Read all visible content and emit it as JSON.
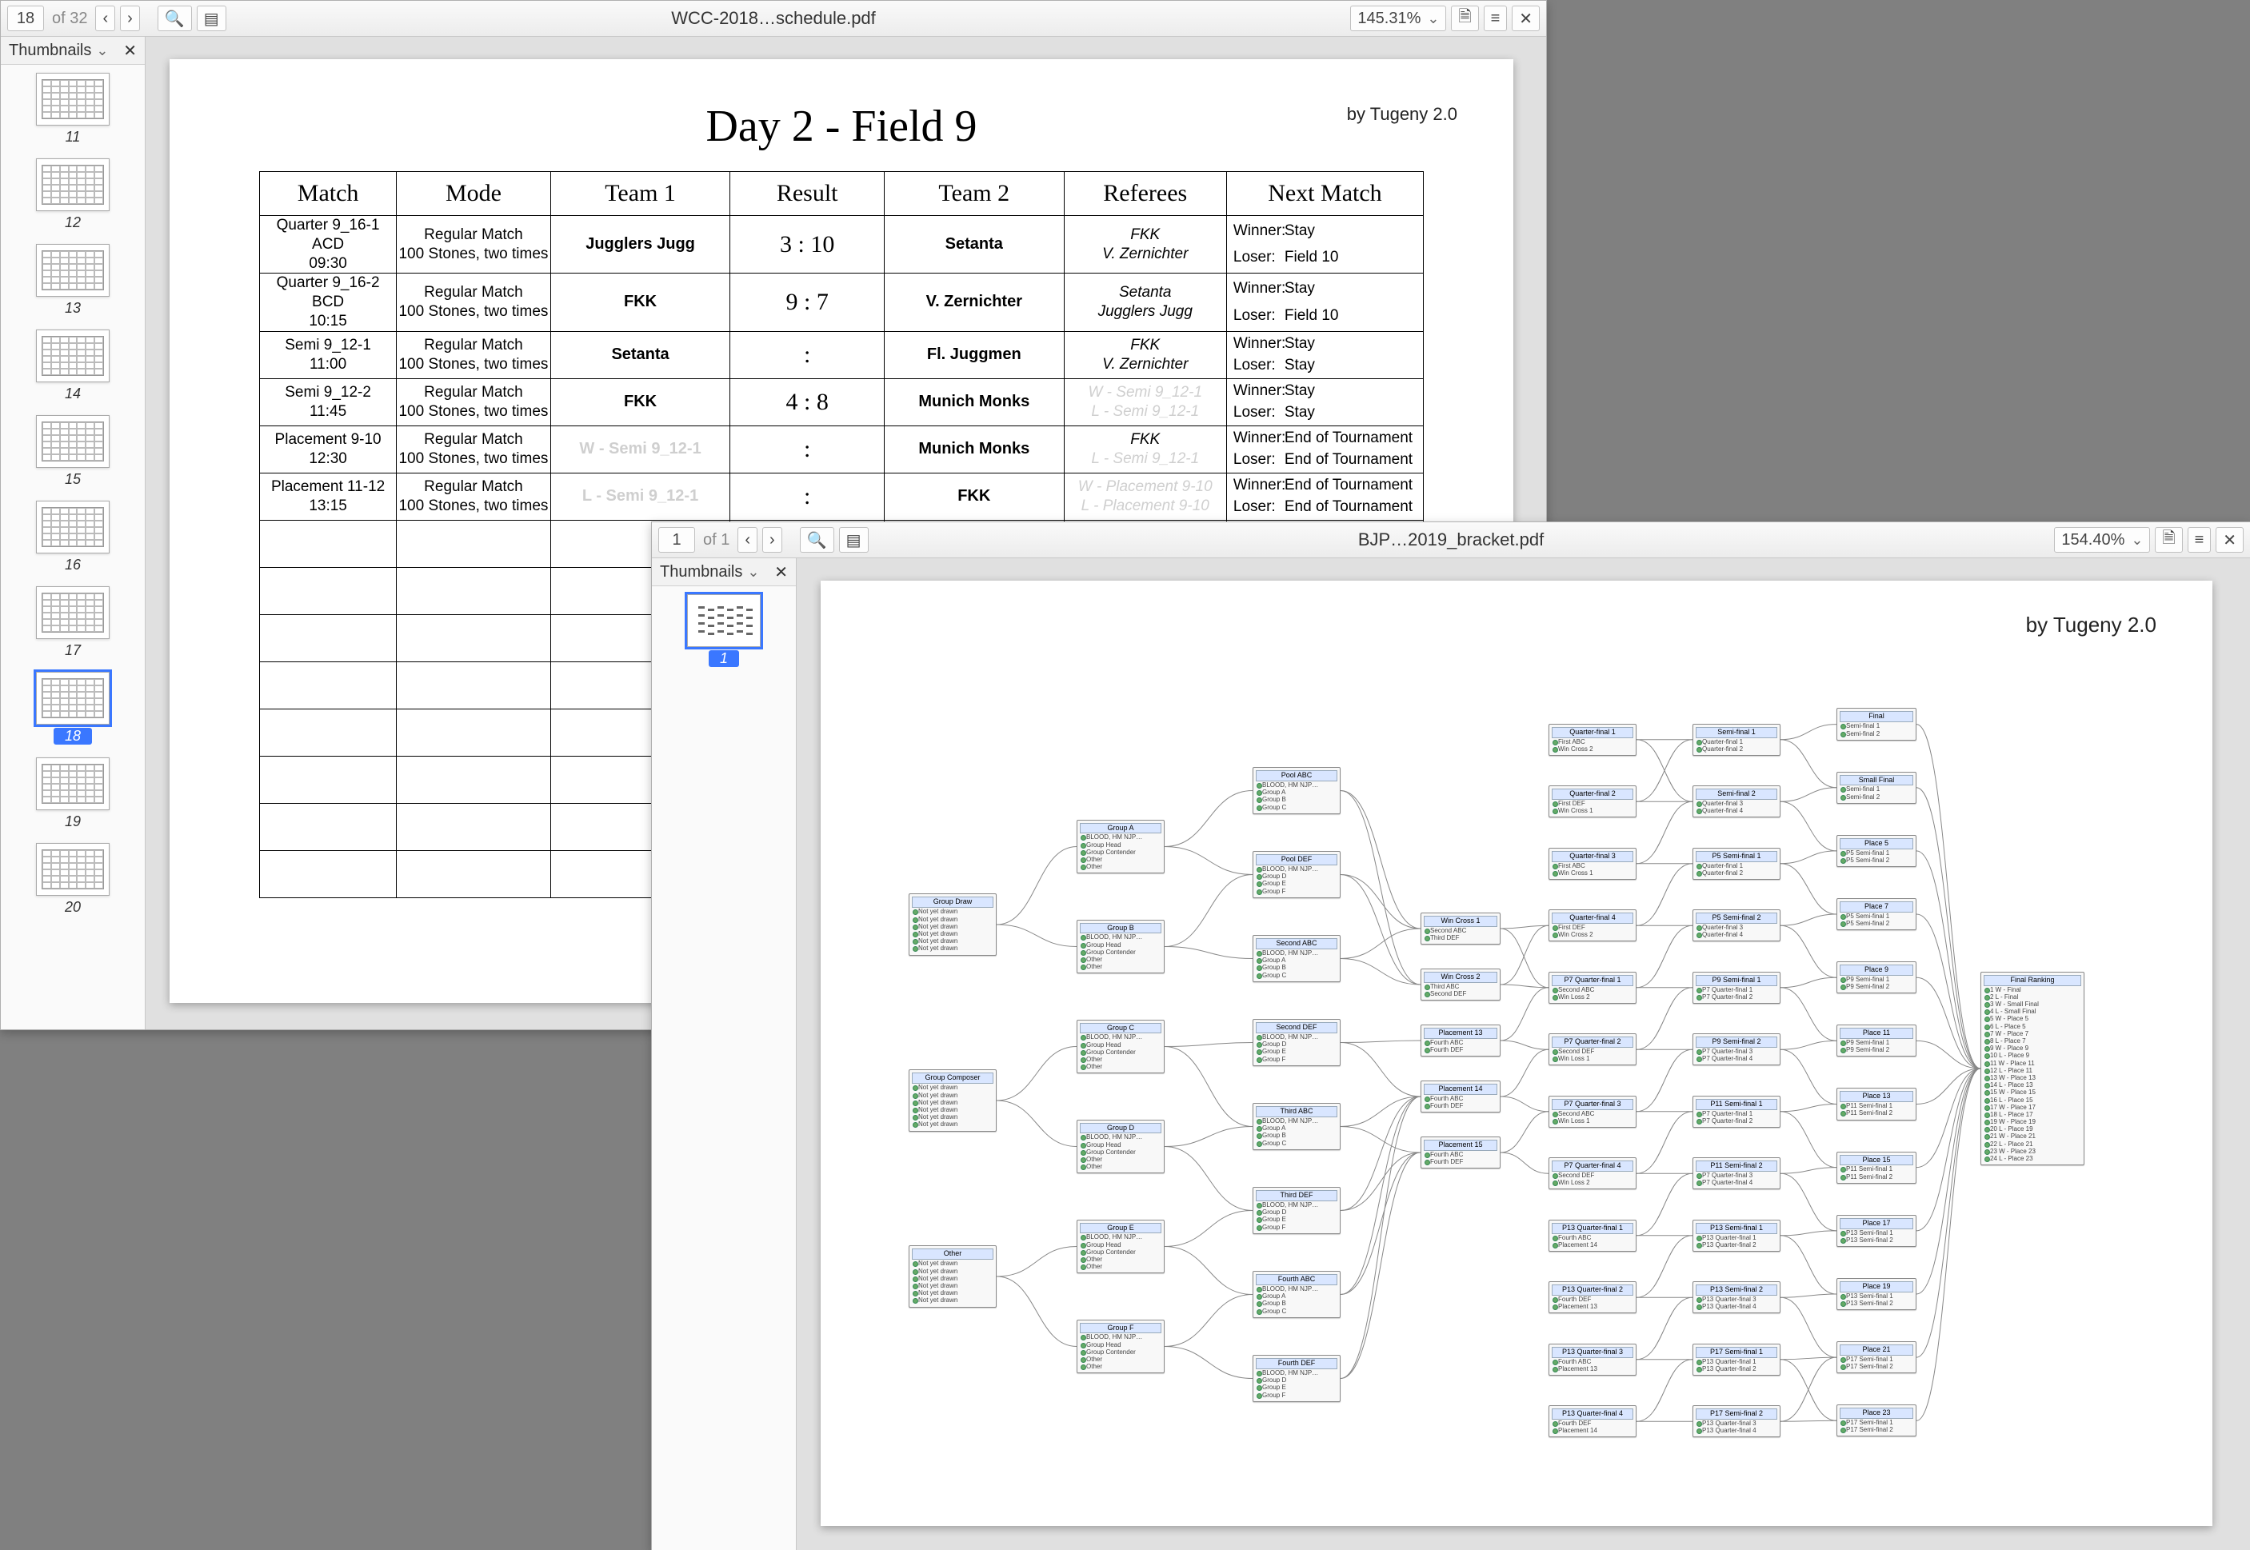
{
  "win1": {
    "page_input": "18",
    "page_total": "of 32",
    "title": "WCC-2018…schedule.pdf",
    "zoom": "145.31%",
    "thumbs_label": "Thumbnails",
    "thumbs": [
      {
        "n": "11"
      },
      {
        "n": "12"
      },
      {
        "n": "13"
      },
      {
        "n": "14"
      },
      {
        "n": "15"
      },
      {
        "n": "16"
      },
      {
        "n": "17"
      },
      {
        "n": "18",
        "selected": true
      },
      {
        "n": "19"
      },
      {
        "n": "20"
      }
    ],
    "byline": "by Tugeny 2.0",
    "page_heading": "Day 2 - Field 9",
    "headers": [
      "Match",
      "Mode",
      "Team 1",
      "Result",
      "Team 2",
      "Referees",
      "Next Match"
    ],
    "next_labels": {
      "winner": "Winner:",
      "loser": "Loser:"
    },
    "rows": [
      {
        "match_l1": "Quarter 9_16-1 ACD",
        "match_l2": "09:30",
        "mode_l1": "Regular Match",
        "mode_l2": "100 Stones, two times",
        "team1": "Jugglers Jugg",
        "team1_ghost": false,
        "result": "3 : 10",
        "team2": "Setanta",
        "team2_ghost": false,
        "ref_l1": "FKK",
        "ref_l2": "V. Zernichter",
        "ref_ghost": false,
        "next_w": "Stay",
        "next_l": "Field 10"
      },
      {
        "match_l1": "Quarter 9_16-2 BCD",
        "match_l2": "10:15",
        "mode_l1": "Regular Match",
        "mode_l2": "100 Stones, two times",
        "team1": "FKK",
        "team1_ghost": false,
        "result": "9 : 7",
        "team2": "V. Zernichter",
        "team2_ghost": false,
        "ref_l1": "Setanta",
        "ref_l2": "Jugglers Jugg",
        "ref_ghost": false,
        "next_w": "Stay",
        "next_l": "Field 10"
      },
      {
        "match_l1": "Semi 9_12-1",
        "match_l2": "11:00",
        "mode_l1": "Regular Match",
        "mode_l2": "100 Stones, two times",
        "team1": "Setanta",
        "team1_ghost": false,
        "result": ":",
        "team2": "Fl. Juggmen",
        "team2_ghost": false,
        "ref_l1": "FKK",
        "ref_l2": "V. Zernichter",
        "ref_ghost": false,
        "next_w": "Stay",
        "next_l": "Stay"
      },
      {
        "match_l1": "Semi 9_12-2",
        "match_l2": "11:45",
        "mode_l1": "Regular Match",
        "mode_l2": "100 Stones, two times",
        "team1": "FKK",
        "team1_ghost": false,
        "result": "4 : 8",
        "team2": "Munich Monks",
        "team2_ghost": false,
        "ref_l1": "W - Semi 9_12-1",
        "ref_l2": "L - Semi 9_12-1",
        "ref_ghost": true,
        "next_w": "Stay",
        "next_l": "Stay"
      },
      {
        "match_l1": "Placement 9-10",
        "match_l2": "12:30",
        "mode_l1": "Regular Match",
        "mode_l2": "100 Stones, two times",
        "team1": "W - Semi 9_12-1",
        "team1_ghost": true,
        "result": ":",
        "team2": "Munich Monks",
        "team2_ghost": false,
        "ref_l1": "FKK",
        "ref_l2": "L - Semi 9_12-1",
        "ref_ghost_l2": true,
        "next_w": "End of Tournament",
        "next_l": "End of Tournament"
      },
      {
        "match_l1": "Placement 11-12",
        "match_l2": "13:15",
        "mode_l1": "Regular Match",
        "mode_l2": "100 Stones, two times",
        "team1": "L - Semi 9_12-1",
        "team1_ghost": true,
        "result": ":",
        "team2": "FKK",
        "team2_ghost": false,
        "ref_l1": "W - Placement 9-10",
        "ref_l2": "L - Placement 9-10",
        "ref_ghost": true,
        "next_w": "End of Tournament",
        "next_l": "End of Tournament"
      }
    ],
    "empty_rows": 8
  },
  "win2": {
    "page_input": "1",
    "page_total": "of 1",
    "title": "BJP…2019_bracket.pdf",
    "zoom": "154.40%",
    "thumbs_label": "Thumbnails",
    "thumbs": [
      {
        "n": "1",
        "selected": true
      }
    ],
    "byline": "by Tugeny 2.0",
    "bracket": {
      "col0": [
        {
          "title": "Group Draw",
          "lines": [
            "Not yet drawn",
            "Not yet drawn",
            "Not yet drawn",
            "Not yet drawn",
            "Not yet drawn",
            "Not yet drawn"
          ]
        },
        {
          "title": "Group Composer",
          "lines": [
            "Not yet drawn",
            "Not yet drawn",
            "Not yet drawn",
            "Not yet drawn",
            "Not yet drawn",
            "Not yet drawn"
          ]
        },
        {
          "title": "Other",
          "lines": [
            "Not yet drawn",
            "Not yet drawn",
            "Not yet drawn",
            "Not yet drawn",
            "Not yet drawn",
            "Not yet drawn"
          ]
        }
      ],
      "col1": [
        {
          "title": "Group A",
          "lines": [
            "BLOOD, HM NJP…",
            "Group Head",
            "Group Contender",
            "Other",
            "Other"
          ]
        },
        {
          "title": "Group B",
          "lines": [
            "BLOOD, HM NJP…",
            "Group Head",
            "Group Contender",
            "Other",
            "Other"
          ]
        },
        {
          "title": "Group C",
          "lines": [
            "BLOOD, HM NJP…",
            "Group Head",
            "Group Contender",
            "Other",
            "Other"
          ]
        },
        {
          "title": "Group D",
          "lines": [
            "BLOOD, HM NJP…",
            "Group Head",
            "Group Contender",
            "Other",
            "Other"
          ]
        },
        {
          "title": "Group E",
          "lines": [
            "BLOOD, HM NJP…",
            "Group Head",
            "Group Contender",
            "Other",
            "Other"
          ]
        },
        {
          "title": "Group F",
          "lines": [
            "BLOOD, HM NJP…",
            "Group Head",
            "Group Contender",
            "Other",
            "Other"
          ]
        }
      ],
      "col2": [
        {
          "title": "Pool ABC",
          "lines": [
            "BLOOD, HM NJP…",
            "Group A",
            "Group B",
            "Group C"
          ]
        },
        {
          "title": "Pool DEF",
          "lines": [
            "BLOOD, HM NJP…",
            "Group D",
            "Group E",
            "Group F"
          ]
        },
        {
          "title": "Second ABC",
          "lines": [
            "BLOOD, HM NJP…",
            "Group A",
            "Group B",
            "Group C"
          ]
        },
        {
          "title": "Second DEF",
          "lines": [
            "BLOOD, HM NJP…",
            "Group D",
            "Group E",
            "Group F"
          ]
        },
        {
          "title": "Third ABC",
          "lines": [
            "BLOOD, HM NJP…",
            "Group A",
            "Group B",
            "Group C"
          ]
        },
        {
          "title": "Third DEF",
          "lines": [
            "BLOOD, HM NJP…",
            "Group D",
            "Group E",
            "Group F"
          ]
        },
        {
          "title": "Fourth ABC",
          "lines": [
            "BLOOD, HM NJP…",
            "Group A",
            "Group B",
            "Group C"
          ]
        },
        {
          "title": "Fourth DEF",
          "lines": [
            "BLOOD, HM NJP…",
            "Group D",
            "Group E",
            "Group F"
          ]
        }
      ],
      "col3": [
        {
          "title": "Win Cross 1",
          "lines": [
            "Second ABC",
            "Third DEF"
          ]
        },
        {
          "title": "Win Cross 2",
          "lines": [
            "Third ABC",
            "Second DEF"
          ]
        },
        {
          "title": "Placement 13",
          "lines": [
            "Fourth ABC",
            "Fourth DEF"
          ]
        },
        {
          "title": "Placement 14",
          "lines": [
            "Fourth ABC",
            "Fourth DEF"
          ]
        },
        {
          "title": "Placement 15",
          "lines": [
            "Fourth ABC",
            "Fourth DEF"
          ]
        }
      ],
      "col4": [
        {
          "title": "Quarter-final 1",
          "lines": [
            "First ABC",
            "Win Cross 2"
          ]
        },
        {
          "title": "Quarter-final 2",
          "lines": [
            "First DEF",
            "Win Cross 1"
          ]
        },
        {
          "title": "Quarter-final 3",
          "lines": [
            "First ABC",
            "Win Cross 1"
          ]
        },
        {
          "title": "Quarter-final 4",
          "lines": [
            "First DEF",
            "Win Cross 2"
          ]
        },
        {
          "title": "P7 Quarter-final 1",
          "lines": [
            "Second ABC",
            "Win Loss 2"
          ]
        },
        {
          "title": "P7 Quarter-final 2",
          "lines": [
            "Second DEF",
            "Win Loss 1"
          ]
        },
        {
          "title": "P7 Quarter-final 3",
          "lines": [
            "Second ABC",
            "Win Loss 1"
          ]
        },
        {
          "title": "P7 Quarter-final 4",
          "lines": [
            "Second DEF",
            "Win Loss 2"
          ]
        },
        {
          "title": "P13 Quarter-final 1",
          "lines": [
            "Fourth ABC",
            "Placement 14"
          ]
        },
        {
          "title": "P13 Quarter-final 2",
          "lines": [
            "Fourth DEF",
            "Placement 13"
          ]
        },
        {
          "title": "P13 Quarter-final 3",
          "lines": [
            "Fourth ABC",
            "Placement 13"
          ]
        },
        {
          "title": "P13 Quarter-final 4",
          "lines": [
            "Fourth DEF",
            "Placement 14"
          ]
        }
      ],
      "col5": [
        {
          "title": "Semi-final 1",
          "lines": [
            "Quarter-final 1",
            "Quarter-final 2"
          ]
        },
        {
          "title": "Semi-final 2",
          "lines": [
            "Quarter-final 3",
            "Quarter-final 4"
          ]
        },
        {
          "title": "P5 Semi-final 1",
          "lines": [
            "Quarter-final 1",
            "Quarter-final 2"
          ]
        },
        {
          "title": "P5 Semi-final 2",
          "lines": [
            "Quarter-final 3",
            "Quarter-final 4"
          ]
        },
        {
          "title": "P9 Semi-final 1",
          "lines": [
            "P7 Quarter-final 1",
            "P7 Quarter-final 2"
          ]
        },
        {
          "title": "P9 Semi-final 2",
          "lines": [
            "P7 Quarter-final 3",
            "P7 Quarter-final 4"
          ]
        },
        {
          "title": "P11 Semi-final 1",
          "lines": [
            "P7 Quarter-final 1",
            "P7 Quarter-final 2"
          ]
        },
        {
          "title": "P11 Semi-final 2",
          "lines": [
            "P7 Quarter-final 3",
            "P7 Quarter-final 4"
          ]
        },
        {
          "title": "P13 Semi-final 1",
          "lines": [
            "P13 Quarter-final 1",
            "P13 Quarter-final 2"
          ]
        },
        {
          "title": "P13 Semi-final 2",
          "lines": [
            "P13 Quarter-final 3",
            "P13 Quarter-final 4"
          ]
        },
        {
          "title": "P17 Semi-final 1",
          "lines": [
            "P13 Quarter-final 1",
            "P13 Quarter-final 2"
          ]
        },
        {
          "title": "P17 Semi-final 2",
          "lines": [
            "P13 Quarter-final 3",
            "P13 Quarter-final 4"
          ]
        }
      ],
      "col6": [
        {
          "title": "Final",
          "lines": [
            "Semi-final 1",
            "Semi-final 2"
          ]
        },
        {
          "title": "Small Final",
          "lines": [
            "Semi-final 1",
            "Semi-final 2"
          ]
        },
        {
          "title": "Place 5",
          "lines": [
            "P5 Semi-final 1",
            "P5 Semi-final 2"
          ]
        },
        {
          "title": "Place 7",
          "lines": [
            "P5 Semi-final 1",
            "P5 Semi-final 2"
          ]
        },
        {
          "title": "Place 9",
          "lines": [
            "P9 Semi-final 1",
            "P9 Semi-final 2"
          ]
        },
        {
          "title": "Place 11",
          "lines": [
            "P9 Semi-final 1",
            "P9 Semi-final 2"
          ]
        },
        {
          "title": "Place 13",
          "lines": [
            "P11 Semi-final 1",
            "P11 Semi-final 2"
          ]
        },
        {
          "title": "Place 15",
          "lines": [
            "P11 Semi-final 1",
            "P11 Semi-final 2"
          ]
        },
        {
          "title": "Place 17",
          "lines": [
            "P13 Semi-final 1",
            "P13 Semi-final 2"
          ]
        },
        {
          "title": "Place 19",
          "lines": [
            "P13 Semi-final 1",
            "P13 Semi-final 2"
          ]
        },
        {
          "title": "Place 21",
          "lines": [
            "P17 Semi-final 1",
            "P17 Semi-final 2"
          ]
        },
        {
          "title": "Place 23",
          "lines": [
            "P17 Semi-final 1",
            "P17 Semi-final 2"
          ]
        }
      ],
      "ranking": {
        "title": "Final Ranking",
        "lines": [
          "1 W - Final",
          "2 L - Final",
          "3 W - Small Final",
          "4 L - Small Final",
          "5 W - Place 5",
          "6 L - Place 5",
          "7 W - Place 7",
          "8 L - Place 7",
          "9 W - Place 9",
          "10 L - Place 9",
          "11 W - Place 11",
          "12 L - Place 11",
          "13 W - Place 13",
          "14 L - Place 13",
          "15 W - Place 15",
          "16 L - Place 15",
          "17 W - Place 17",
          "18 L - Place 17",
          "19 W - Place 19",
          "20 L - Place 19",
          "21 W - Place 21",
          "22 L - Place 21",
          "23 W - Place 23",
          "24 L - Place 23"
        ]
      }
    }
  }
}
